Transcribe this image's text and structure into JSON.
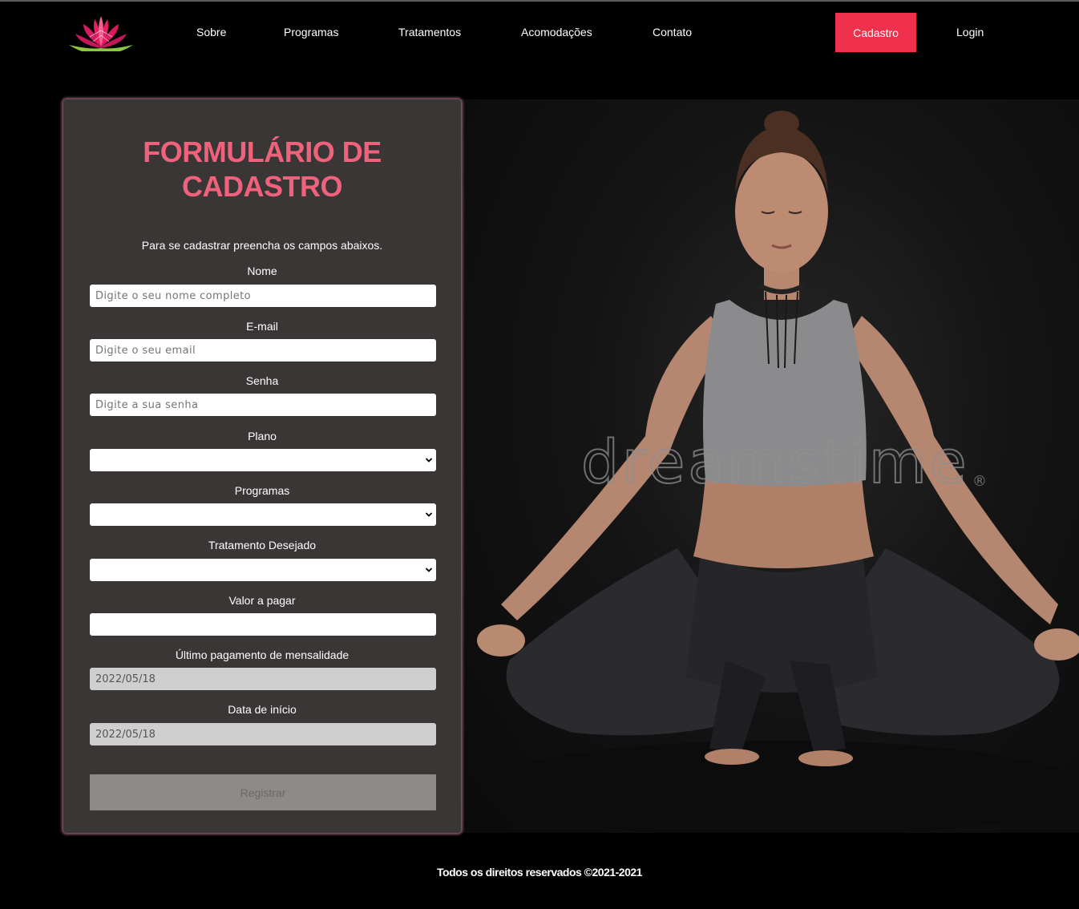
{
  "nav": {
    "logo_icon": "lotus-flower-icon",
    "items": [
      {
        "label": "Sobre"
      },
      {
        "label": "Programas"
      },
      {
        "label": "Tratamentos"
      },
      {
        "label": "Acomodações"
      },
      {
        "label": "Contato"
      }
    ],
    "cadastro_label": "Cadastro",
    "login_label": "Login",
    "accent_color": "#f0314e"
  },
  "form": {
    "title_line1": "FORMULÁRIO DE",
    "title_line2": "CADASTRO",
    "subtitle": "Para se cadastrar preencha os campos abaixos.",
    "nome": {
      "label": "Nome",
      "placeholder": "Digite o seu nome completo"
    },
    "email": {
      "label": "E-mail",
      "placeholder": "Digite o seu email"
    },
    "senha": {
      "label": "Senha",
      "placeholder": "Digite a sua senha"
    },
    "plano": {
      "label": "Plano",
      "value": ""
    },
    "programas": {
      "label": "Programas",
      "value": ""
    },
    "tratamento": {
      "label": "Tratamento Desejado",
      "value": ""
    },
    "valor": {
      "label": "Valor a pagar",
      "value": ""
    },
    "ultimo_pagamento": {
      "label": "Último pagamento de mensalidade",
      "value": "2022/05/18"
    },
    "data_inicio": {
      "label": "Data de início",
      "value": "2022/05/18"
    },
    "submit_label": "Registrar",
    "title_color": "#f0627c"
  },
  "hero": {
    "watermark": "dreamstime",
    "watermark_mark": "®"
  },
  "footer": {
    "text": "Todos os direitos reservados ©2021-2021"
  }
}
